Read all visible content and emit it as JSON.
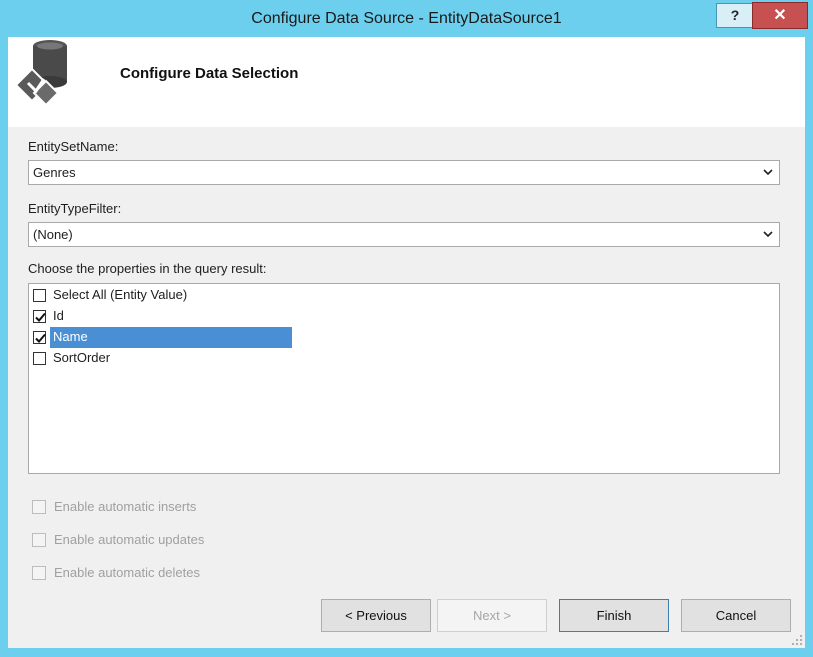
{
  "window": {
    "title": "Configure Data Source - EntityDataSource1",
    "help_label": "?",
    "close_label": "✕"
  },
  "header": {
    "title": "Configure Data Selection",
    "icon": "database-wizard-icon"
  },
  "entity_set": {
    "label": "EntitySetName:",
    "value": "Genres"
  },
  "entity_type": {
    "label": "EntityTypeFilter:",
    "value": "(None)"
  },
  "properties": {
    "label": "Choose the properties in the query result:",
    "items": [
      {
        "label": "Select All (Entity Value)",
        "checked": false,
        "selected": false
      },
      {
        "label": "Id",
        "checked": true,
        "selected": false
      },
      {
        "label": "Name",
        "checked": true,
        "selected": true
      },
      {
        "label": "SortOrder",
        "checked": false,
        "selected": false
      }
    ]
  },
  "options": {
    "inserts": "Enable automatic inserts",
    "updates": "Enable automatic updates",
    "deletes": "Enable automatic deletes"
  },
  "buttons": {
    "previous": "< Previous",
    "next": "Next >",
    "finish": "Finish",
    "cancel": "Cancel"
  },
  "colors": {
    "titlebar": "#6ccfee",
    "selection": "#4a8fd4",
    "close": "#c75050"
  }
}
